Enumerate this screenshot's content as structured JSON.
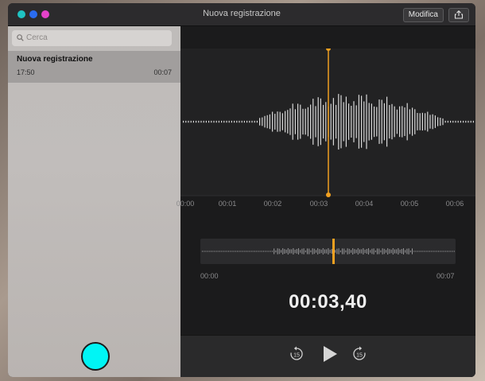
{
  "window": {
    "title": "Nuova registrazione"
  },
  "toolbar": {
    "edit_label": "Modifica",
    "share_icon": "share-icon"
  },
  "search": {
    "placeholder": "Cerca",
    "icon": "search-icon"
  },
  "recordings": [
    {
      "title": "Nuova registrazione",
      "time": "17:50",
      "duration": "00:07",
      "selected": true
    }
  ],
  "timeline": {
    "ticks": [
      "00:00",
      "00:01",
      "00:02",
      "00:03",
      "00:04",
      "00:05",
      "00:06"
    ]
  },
  "overview": {
    "start": "00:00",
    "end": "00:07"
  },
  "playback": {
    "current_time": "00:03,40",
    "position_fraction": 0.486,
    "skip_back_seconds": "15",
    "skip_forward_seconds": "15"
  },
  "colors": {
    "playhead": "#f0a020",
    "record_button": "#00f5f5",
    "waveform": "#d8d8d8"
  }
}
